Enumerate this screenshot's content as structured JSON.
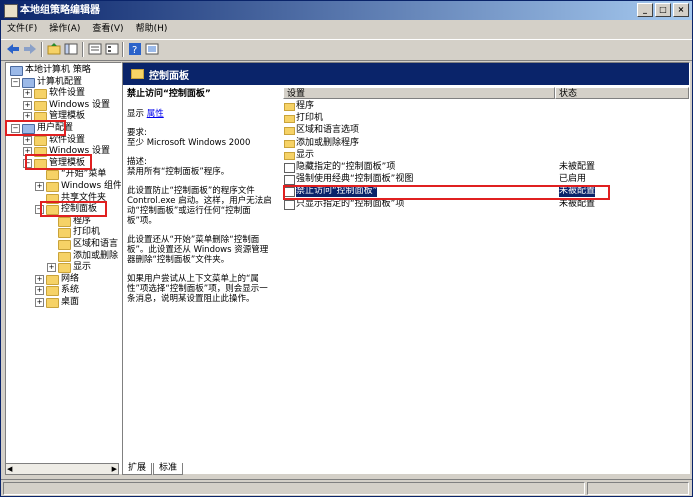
{
  "window": {
    "title": "本地组策略编辑器",
    "controls": [
      "_",
      "□",
      "×"
    ]
  },
  "menu": [
    "文件(F)",
    "操作(A)",
    "查看(V)",
    "帮助(H)"
  ],
  "tree": [
    {
      "label": "本地计算机 策略",
      "indent": 0,
      "expander": ""
    },
    {
      "label": "计算机配置",
      "indent": 1,
      "expander": "−"
    },
    {
      "label": "软件设置",
      "indent": 2,
      "expander": "+"
    },
    {
      "label": "Windows 设置",
      "indent": 2,
      "expander": "+"
    },
    {
      "label": "管理模板",
      "indent": 2,
      "expander": "+"
    },
    {
      "label": "用户配置",
      "indent": 1,
      "expander": "−"
    },
    {
      "label": "软件设置",
      "indent": 2,
      "expander": "+"
    },
    {
      "label": "Windows 设置",
      "indent": 2,
      "expander": "+"
    },
    {
      "label": "管理模板",
      "indent": 2,
      "expander": "−"
    },
    {
      "label": "“开始”菜单",
      "indent": 3,
      "expander": ""
    },
    {
      "label": "Windows 组件",
      "indent": 3,
      "expander": "+"
    },
    {
      "label": "共享文件夹",
      "indent": 3,
      "expander": ""
    },
    {
      "label": "控制面板",
      "indent": 3,
      "expander": "−"
    },
    {
      "label": "程序",
      "indent": 4,
      "expander": ""
    },
    {
      "label": "打印机",
      "indent": 4,
      "expander": ""
    },
    {
      "label": "区域和语言",
      "indent": 4,
      "expander": ""
    },
    {
      "label": "添加或删除",
      "indent": 4,
      "expander": ""
    },
    {
      "label": "显示",
      "indent": 4,
      "expander": "+"
    },
    {
      "label": "网络",
      "indent": 3,
      "expander": "+"
    },
    {
      "label": "系统",
      "indent": 3,
      "expander": "+"
    },
    {
      "label": "桌面",
      "indent": 3,
      "expander": "+"
    }
  ],
  "right": {
    "header": "控制面板",
    "desc": {
      "title": "禁止访问“控制面板”",
      "show_label": "显示",
      "show_link": "属性",
      "req_label": "要求:",
      "req_text": "至少 Microsoft Windows 2000",
      "note_label": "描述:",
      "note_text": "禁用所有“控制面板”程序。",
      "para1": "此设置防止“控制面板”的程序文件 Control.exe 启动。这样，用户无法启动“控制面板”或运行任何“控制面板”项。",
      "para2": "此设置还从“开始”菜单删除“控制面板”。此设置还从 Windows 资源管理器删除“控制面板”文件夹。",
      "para3": "如果用户尝试从上下文菜单上的“属性”项选择“控制面板”项，则会显示一条消息，说明某设置阻止此操作。"
    },
    "list": {
      "col_setting": "设置",
      "col_state": "状态",
      "rows": [
        {
          "name": "程序",
          "state": "",
          "type": "folder"
        },
        {
          "name": "打印机",
          "state": "",
          "type": "folder"
        },
        {
          "name": "区域和语言选项",
          "state": "",
          "type": "folder"
        },
        {
          "name": "添加或删除程序",
          "state": "",
          "type": "folder"
        },
        {
          "name": "显示",
          "state": "",
          "type": "folder"
        },
        {
          "name": "隐藏指定的“控制面板”项",
          "state": "未被配置",
          "type": "policy"
        },
        {
          "name": "强制使用经典“控制面板”视图",
          "state": "已启用",
          "type": "policy"
        },
        {
          "name": "禁止访问“控制面板”",
          "state": "未被配置",
          "type": "policy",
          "selected": true
        },
        {
          "name": "只显示指定的“控制面板”项",
          "state": "未被配置",
          "type": "policy"
        }
      ]
    }
  },
  "tabs": {
    "extended": "扩展",
    "standard": "标准"
  }
}
